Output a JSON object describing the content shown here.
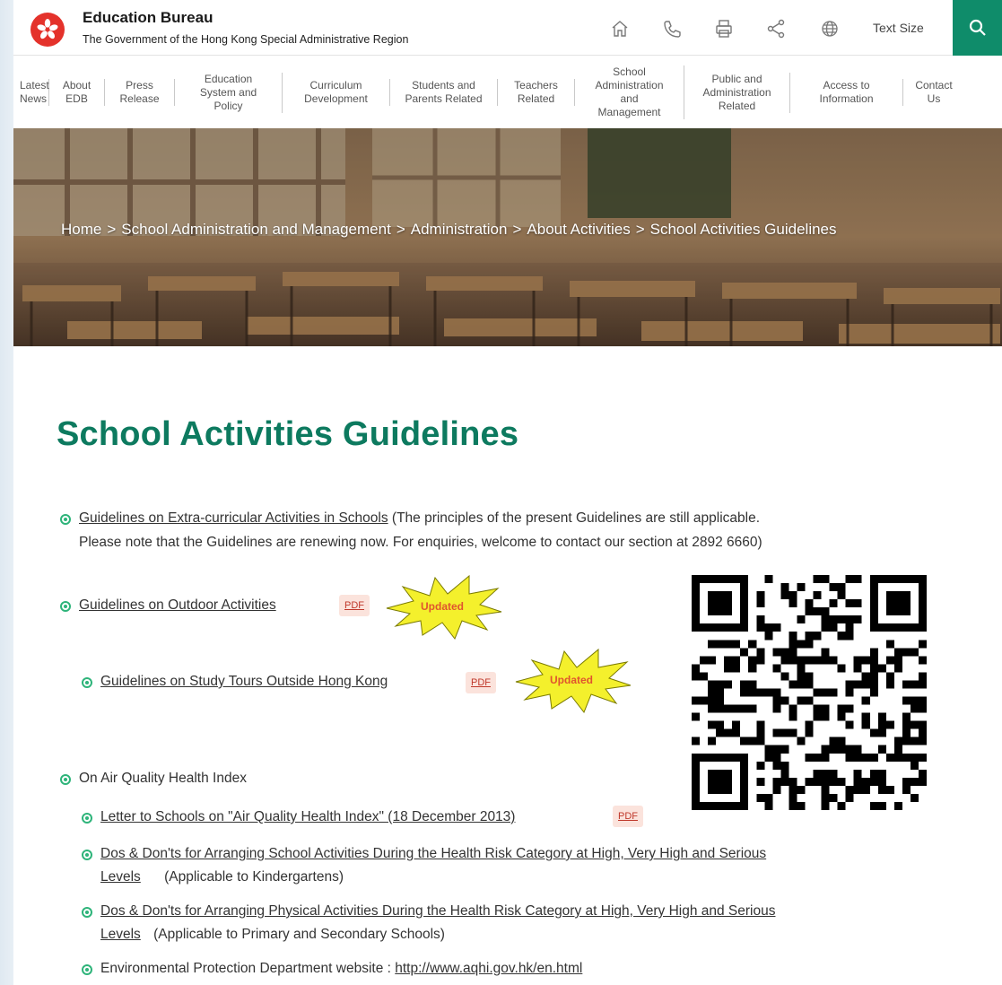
{
  "header": {
    "title": "Education Bureau",
    "subtitle": "The Government of the Hong Kong Special Administrative Region",
    "text_size_label": "Text Size",
    "icons": [
      "home-icon",
      "phone-icon",
      "print-icon",
      "share-icon",
      "globe-icon",
      "search-icon"
    ],
    "accent_color": "#0f8c6a"
  },
  "nav": {
    "items": [
      [
        "Latest",
        "News"
      ],
      [
        "About",
        "EDB"
      ],
      [
        "Press",
        "Release"
      ],
      [
        "Education",
        "System and",
        "Policy"
      ],
      [
        "Curriculum",
        "Development"
      ],
      [
        "Students and",
        "Parents Related"
      ],
      [
        "Teachers",
        "Related"
      ],
      [
        "School",
        "Administration",
        "and",
        "Management"
      ],
      [
        "Public and",
        "Administration",
        "Related"
      ],
      [
        "Access to",
        "Information"
      ],
      [
        "Contact",
        "Us"
      ]
    ]
  },
  "breadcrumb": [
    "Home",
    "School Administration and Management",
    "Administration",
    "About Activities",
    "School Activities Guidelines"
  ],
  "breadcrumb_separator": ">",
  "content": {
    "title": "School Activities Guidelines",
    "item1_link": "Guidelines on Extra-curricular Activities in Schools",
    "item1_note_a": "(The principles of the present Guidelines are still applicable.",
    "item1_note_b": "Please note that the Guidelines are renewing now.  For enquiries, welcome to contact our section at 2892 6660)",
    "item2_link": "Guidelines on Outdoor Activities",
    "item3_link": "Guidelines on Study Tours Outside Hong Kong",
    "pdf_label": "PDF",
    "updated_label": "Updated",
    "item4_label": "On Air Quality Health Index",
    "sub1_link": "Letter to Schools on \"Air Quality Health Index\" (18 December 2013)",
    "sub2_link_a": "Dos & Don'ts for Arranging School Activities During the Health Risk Category at High, Very High and Serious",
    "sub2_link_b": "Levels",
    "sub2_note": "(Applicable to Kindergartens)",
    "sub3_link_a": "Dos & Don'ts for Arranging Physical Activities During the Health Risk Category at High, Very High and Serious",
    "sub3_link_b": "Levels",
    "sub3_note": "(Applicable to Primary and Secondary Schools)",
    "sub4_label": "Environmental Protection Department website : ",
    "sub4_link": "http://www.aqhi.gov.hk/en.html",
    "title_color": "#0d7a5f",
    "bullet_color": "#2eb47a"
  }
}
